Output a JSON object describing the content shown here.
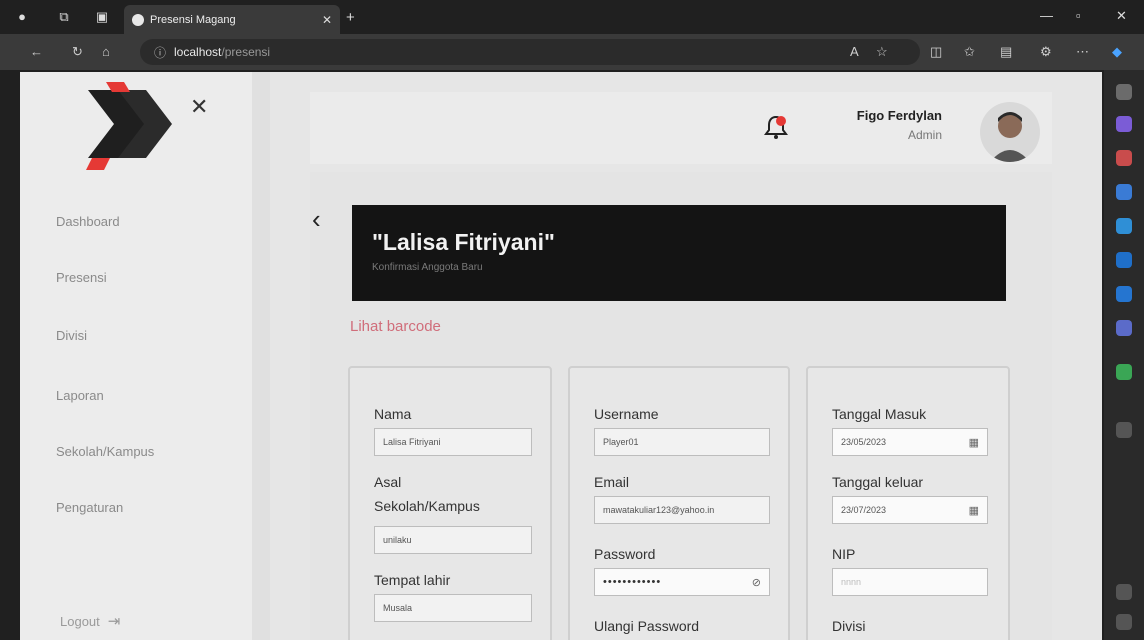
{
  "browser": {
    "tab_title": "Presensi Magang",
    "url_host": "localhost",
    "url_path": "/presensi"
  },
  "sidebar": {
    "items": [
      {
        "label": "Dashboard"
      },
      {
        "label": "Presensi"
      },
      {
        "label": "Divisi"
      },
      {
        "label": "Laporan"
      },
      {
        "label": "Sekolah/Kampus"
      },
      {
        "label": "Pengaturan"
      }
    ],
    "logout_label": "Logout"
  },
  "header": {
    "user_name": "Figo Ferdylan",
    "user_role": "Admin"
  },
  "banner": {
    "title": "\"Lalisa Fitriyani\"",
    "subtitle": "Konfirmasi Anggota Baru"
  },
  "barcode_link": "Lihat barcode",
  "form": {
    "nama": {
      "label": "Nama",
      "value": "Lalisa Fitriyani"
    },
    "asal": {
      "label_line1": "Asal",
      "label_line2": "Sekolah/Kampus",
      "value": "unilaku"
    },
    "tempat_lahir": {
      "label": "Tempat lahir",
      "value": "Musala"
    },
    "username": {
      "label": "Username",
      "value": "Player01"
    },
    "email": {
      "label": "Email",
      "value": "mawatakuliar123@yahoo.in"
    },
    "password": {
      "label": "Password",
      "value": "••••••••••••"
    },
    "ulangi_password": {
      "label": "Ulangi Password"
    },
    "tanggal_masuk": {
      "label": "Tanggal Masuk",
      "value": "23/05/2023"
    },
    "tanggal_keluar": {
      "label": "Tanggal keluar",
      "value": "23/07/2023"
    },
    "nip": {
      "label": "NIP",
      "placeholder": "nnnn"
    },
    "divisi": {
      "label": "Divisi"
    }
  },
  "colors": {
    "accent": "#d06d7a",
    "banner_bg": "#141414",
    "logo_red": "#e53935"
  }
}
